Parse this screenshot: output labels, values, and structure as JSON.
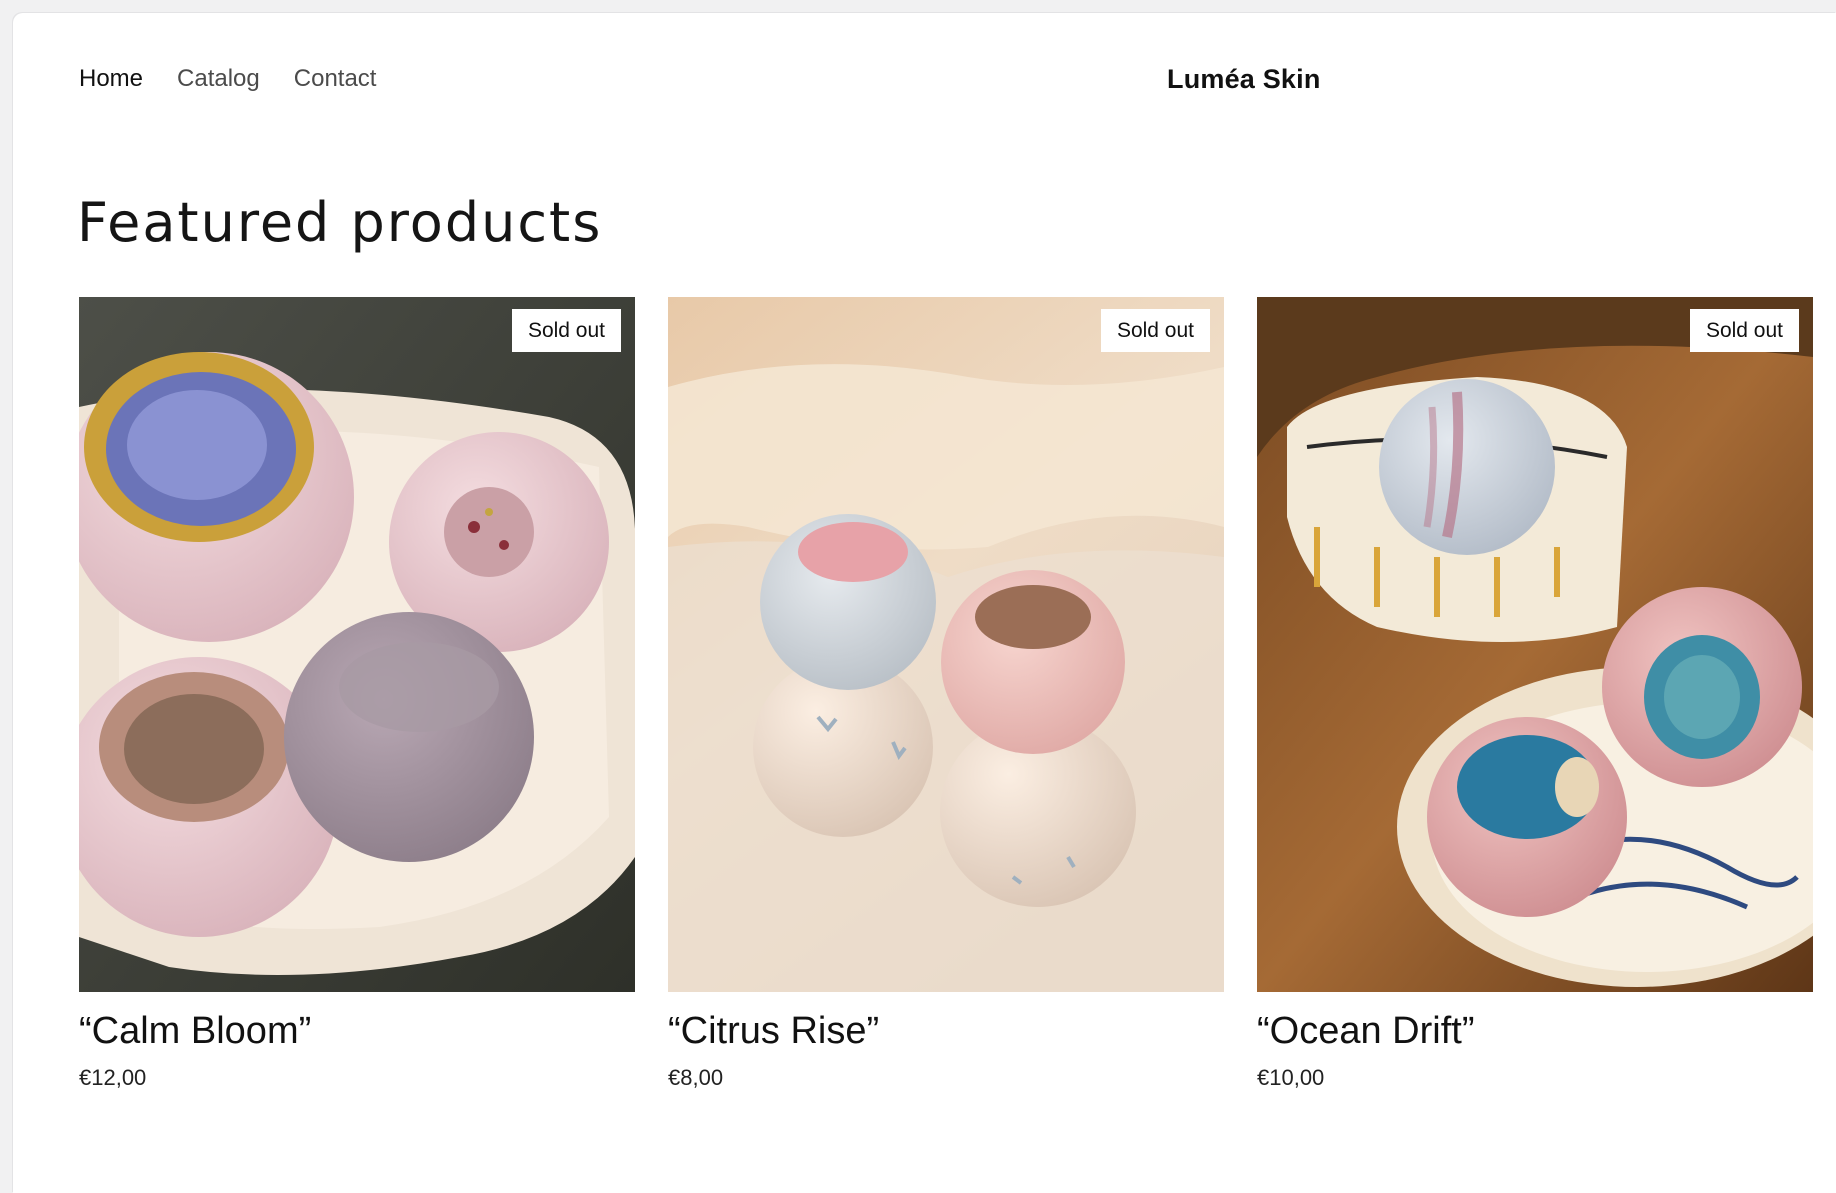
{
  "nav": {
    "items": [
      {
        "label": "Home"
      },
      {
        "label": "Catalog"
      },
      {
        "label": "Contact"
      }
    ]
  },
  "brand": "Luméa Skin",
  "section": {
    "heading": "Featured products"
  },
  "products": [
    {
      "title": "“Calm Bloom”",
      "price": "€12,00",
      "badge": "Sold out"
    },
    {
      "title": "“Citrus Rise”",
      "price": "€8,00",
      "badge": "Sold out"
    },
    {
      "title": "“Ocean Drift”",
      "price": "€10,00",
      "badge": "Sold out"
    }
  ]
}
